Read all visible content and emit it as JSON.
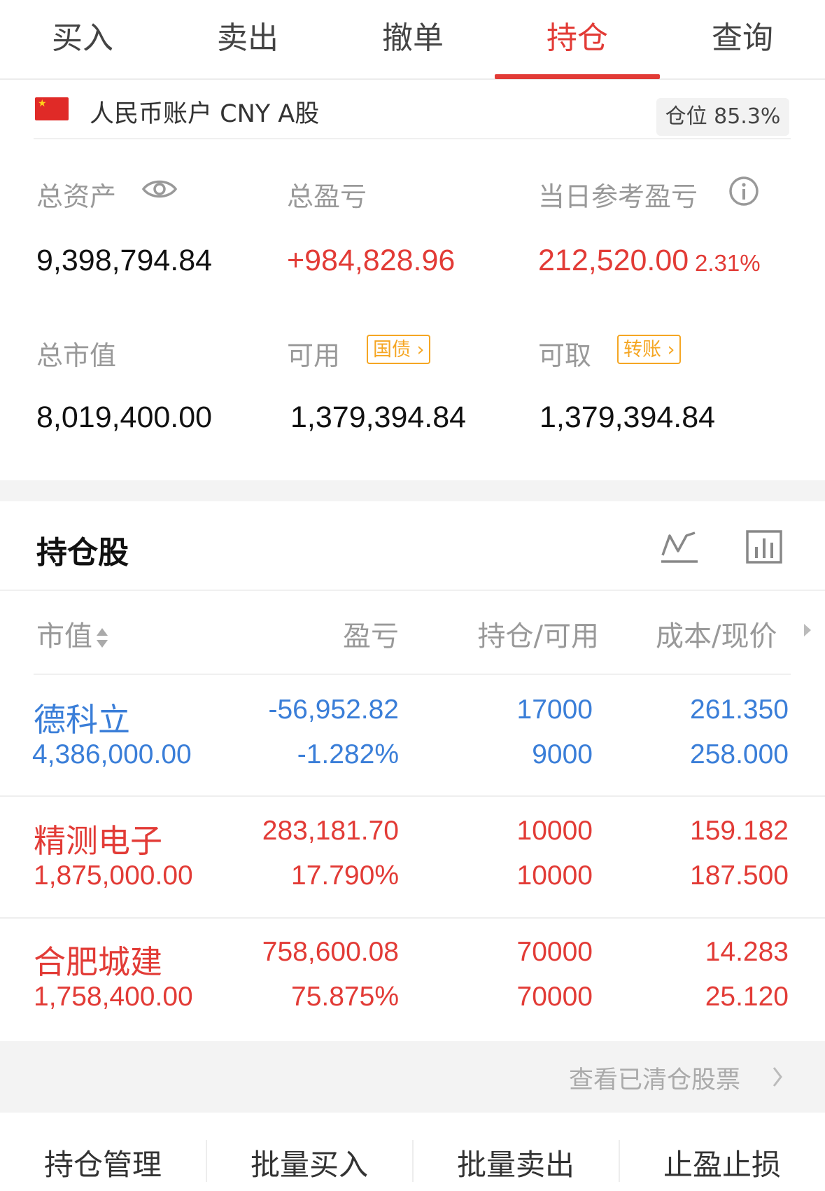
{
  "tabs": [
    {
      "label": "买入"
    },
    {
      "label": "卖出"
    },
    {
      "label": "撤单"
    },
    {
      "label": "持仓"
    },
    {
      "label": "查询"
    }
  ],
  "active_tab": "持仓",
  "account": {
    "name": "人民币账户 CNY A股",
    "position_ratio": "仓位 85.3%"
  },
  "summary": {
    "total_assets_label": "总资产",
    "total_assets": "9,398,794.84",
    "total_pnl_label": "总盈亏",
    "total_pnl": "+984,828.96",
    "daily_pnl_label": "当日参考盈亏",
    "daily_pnl": "212,520.00",
    "daily_pnl_pct": "2.31%",
    "market_value_label": "总市值",
    "market_value": "8,019,400.00",
    "available_label": "可用",
    "available_tag": "国债",
    "available": "1,379,394.84",
    "withdrawable_label": "可取",
    "withdrawable_tag": "转账",
    "withdrawable": "1,379,394.84"
  },
  "holdings": {
    "title": "持仓股",
    "columns": {
      "market_value": "市值",
      "pnl": "盈亏",
      "qty": "持仓/可用",
      "price": "成本/现价"
    },
    "rows": [
      {
        "name": "德科立",
        "market_value": "4,386,000.00",
        "pnl": "-56,952.82",
        "pnl_pct": "-1.282%",
        "hold": "17000",
        "available": "9000",
        "cost": "261.350",
        "price": "258.000"
      },
      {
        "name": "精测电子",
        "market_value": "1,875,000.00",
        "pnl": "283,181.70",
        "pnl_pct": "17.790%",
        "hold": "10000",
        "available": "10000",
        "cost": "159.182",
        "price": "187.500"
      },
      {
        "name": "合肥城建",
        "market_value": "1,758,400.00",
        "pnl": "758,600.08",
        "pnl_pct": "75.875%",
        "hold": "70000",
        "available": "70000",
        "cost": "14.283",
        "price": "25.120"
      }
    ],
    "view_cleared": "查看已清仓股票"
  },
  "bottom_actions": [
    {
      "label": "持仓管理"
    },
    {
      "label": "批量买入"
    },
    {
      "label": "批量卖出"
    },
    {
      "label": "止盈止损"
    }
  ],
  "colors": {
    "accent": "#e23b36",
    "loss": "#3a7ed8",
    "tag": "#f5a623"
  }
}
